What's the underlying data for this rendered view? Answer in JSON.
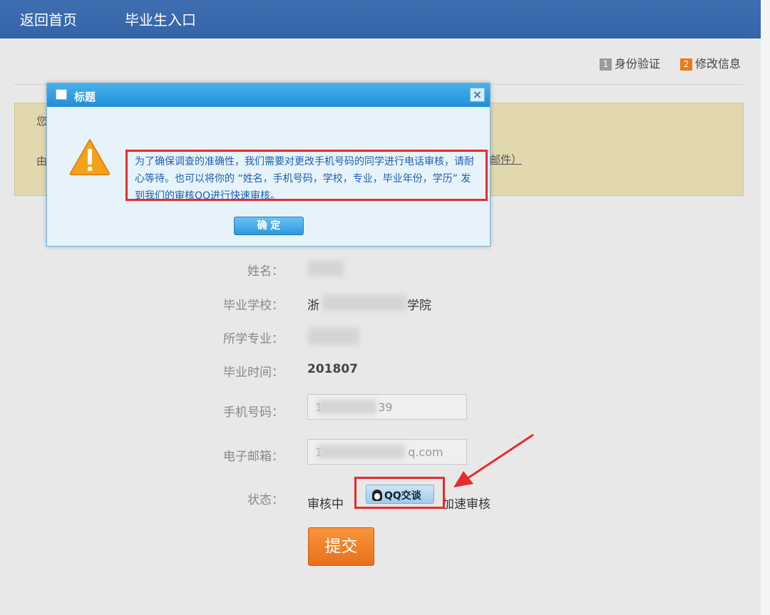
{
  "nav": {
    "home": "返回首页",
    "graduate": "毕业生入口"
  },
  "steps": [
    {
      "num": "1",
      "label": "身份验证",
      "color": "#9c9c9c"
    },
    {
      "num": "2",
      "label": "修改信息",
      "color": "#ea7a1f"
    }
  ],
  "notice": {
    "frag1": "您",
    "frag2": "由",
    "frag3": "邮件）"
  },
  "modal": {
    "title": "标题",
    "message": "为了确保调查的准确性，我们需要对更改手机号码的同学进行电话审核，请耐心等待。也可以将你的 “姓名，手机号码，学校，专业，毕业年份，学历” 发到我们的审核QQ进行快速审核。",
    "ok": "确 定",
    "close": "×"
  },
  "form": {
    "name_label": "姓名：",
    "name_value": "",
    "school_label": "毕业学校：",
    "school_prefix": "浙",
    "school_suffix": "学院",
    "major_label": "所学专业：",
    "gradtime_label": "毕业时间：",
    "gradtime_value": "201807",
    "phone_label": "手机号码：",
    "phone_prefix": "1",
    "phone_suffix": "39",
    "email_label": "电子邮箱：",
    "email_prefix": "1",
    "email_suffix": "q.com",
    "status_label": "状态：",
    "status_value": "审核中",
    "qq_button": "QQ交谈",
    "speed_text": "加速审核",
    "submit": "提交"
  },
  "colors": {
    "highlight": "#e62c2c",
    "topbar": "#3563a8"
  }
}
